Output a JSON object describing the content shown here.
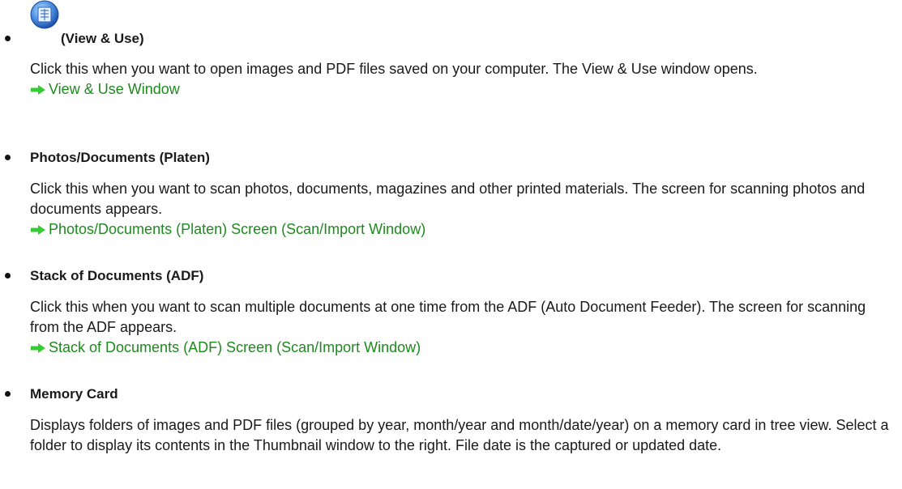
{
  "items": [
    {
      "heading": "(View & Use)",
      "icon": "view-use-icon",
      "description": "Click this when you want to open images and PDF files saved on your computer. The View & Use window opens.",
      "link": "View & Use Window"
    },
    {
      "heading": "Photos/Documents (Platen)",
      "description": "Click this when you want to scan photos, documents, magazines and other printed materials. The screen for scanning photos and documents appears.",
      "link": "Photos/Documents (Platen) Screen (Scan/Import Window)"
    },
    {
      "heading": "Stack of Documents (ADF)",
      "description": "Click this when you want to scan multiple documents at one time from the ADF (Auto Document Feeder). The screen for scanning from the ADF appears.",
      "link": "Stack of Documents (ADF) Screen (Scan/Import Window)"
    },
    {
      "heading": "Memory Card",
      "description": "Displays folders of images and PDF files (grouped by year, month/year and month/date/year) on a memory card in tree view. Select a folder to display its contents in the Thumbnail window to the right. File date is the captured or updated date."
    }
  ],
  "colors": {
    "link": "#1e8a1e",
    "arrow": "#33cc33",
    "text": "#1a1a1a"
  }
}
